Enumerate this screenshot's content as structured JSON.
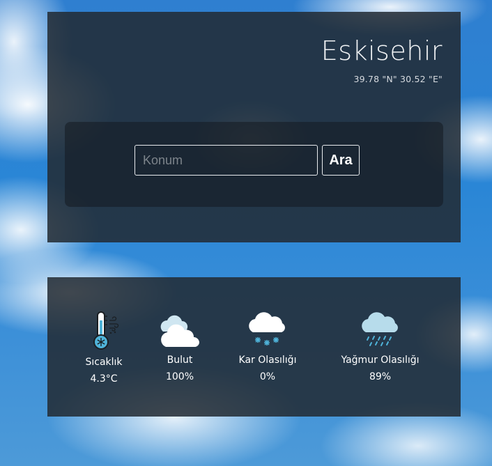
{
  "location": {
    "city": "Eskisehir",
    "coordinates": "39.78 \"N\" 30.52 \"E\""
  },
  "search": {
    "placeholder": "Konum",
    "value": "",
    "button_label": "Ara"
  },
  "stats": {
    "temperature": {
      "label": "Sıcaklık",
      "value": "4.3°C",
      "icon": "thermometer-snow-icon"
    },
    "cloud": {
      "label": "Bulut",
      "value": "100%",
      "icon": "cloud-icon"
    },
    "snow": {
      "label": "Kar Olasılığı",
      "value": "0%",
      "icon": "snow-cloud-icon"
    },
    "rain": {
      "label": "Yağmur Olasılığı",
      "value": "89%",
      "icon": "rain-cloud-icon"
    }
  },
  "colors": {
    "panel": "#222a32",
    "text": "#ffffff",
    "icon_blue": "#4fb3d9",
    "cloud_light_blue": "#b7dceb"
  }
}
